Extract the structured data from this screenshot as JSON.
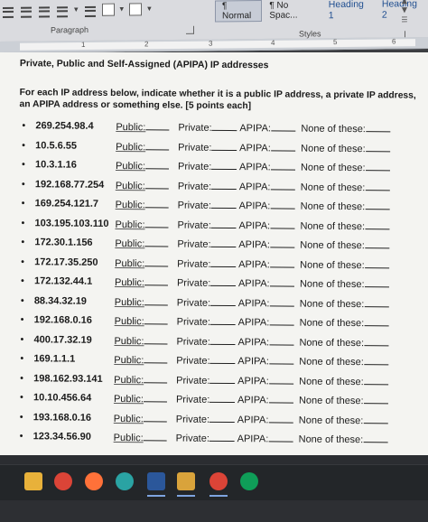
{
  "ribbon": {
    "paragraph_group_label": "Paragraph",
    "styles_group_label": "Styles",
    "styles": [
      {
        "label": "¶ Normal",
        "active": true
      },
      {
        "label": "¶ No Spac...",
        "active": false
      },
      {
        "label": "Heading 1",
        "active": false
      },
      {
        "label": "Heading 2",
        "active": false
      }
    ],
    "icons": [
      "align-left-icon",
      "align-center-icon",
      "justify-icon",
      "line-spacing-icon",
      "sort-icon",
      "shading-icon",
      "borders-icon"
    ]
  },
  "ruler": {
    "numbers": [
      "1",
      "2",
      "3",
      "4",
      "5",
      "6"
    ]
  },
  "document": {
    "title": "Private, Public and Self-Assigned (APIPA) IP addresses",
    "instructions": "For each IP address below, indicate whether it is a public IP address, a private IP address, an APIPA address or something else. [5 points each]",
    "option_labels": {
      "public": "Public:",
      "private": "Private:",
      "apipa": "APIPA:",
      "none": "None of these:"
    },
    "ip_addresses": [
      "269.254.98.4",
      "10.5.6.55",
      "10.3.1.16",
      "192.168.77.254",
      "169.254.121.7",
      "103.195.103.110",
      "172.30.1.156",
      "172.17.35.250",
      "172.132.44.1",
      "88.34.32.19",
      "192.168.0.16",
      "400.17.32.19",
      "169.1.1.1",
      "198.162.93.141",
      "10.10.456.64",
      "193.168.0.16",
      "123.34.56.90"
    ]
  },
  "taskbar": {
    "apps": [
      {
        "name": "file-explorer-icon",
        "color": "#e8b13a"
      },
      {
        "name": "chrome-icon",
        "color": "#db4437"
      },
      {
        "name": "firefox-icon",
        "color": "#ff7139"
      },
      {
        "name": "edge-icon",
        "color": "#2aa3a3"
      },
      {
        "name": "word-icon",
        "color": "#2b579a"
      },
      {
        "name": "files-icon",
        "color": "#d9a33b"
      },
      {
        "name": "chrome-profile-icon",
        "color": "#db4437"
      },
      {
        "name": "chrome-alt-icon",
        "color": "#0f9d58"
      }
    ]
  }
}
